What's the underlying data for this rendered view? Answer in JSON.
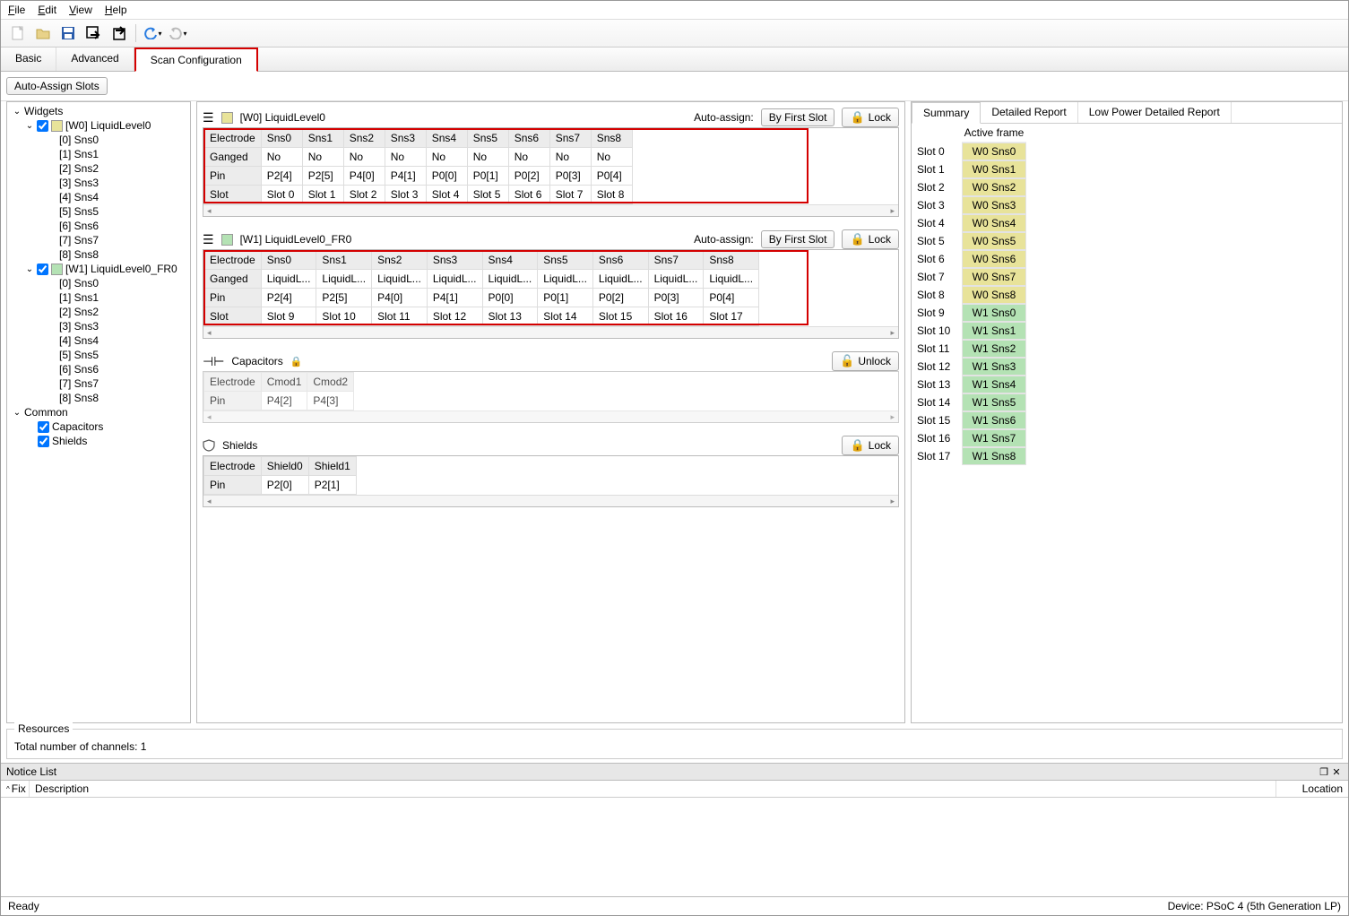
{
  "menubar": {
    "file": "File",
    "edit": "Edit",
    "view": "View",
    "help": "Help"
  },
  "tabs": {
    "basic": "Basic",
    "advanced": "Advanced",
    "scanconfig": "Scan Configuration"
  },
  "subbar": {
    "autoassign": "Auto-Assign Slots"
  },
  "tree": {
    "widgets": "Widgets",
    "w0": {
      "label": "[W0] LiquidLevel0",
      "sns": [
        "[0] Sns0",
        "[1] Sns1",
        "[2] Sns2",
        "[3] Sns3",
        "[4] Sns4",
        "[5] Sns5",
        "[6] Sns6",
        "[7] Sns7",
        "[8] Sns8"
      ]
    },
    "w1": {
      "label": "[W1] LiquidLevel0_FR0",
      "sns": [
        "[0] Sns0",
        "[1] Sns1",
        "[2] Sns2",
        "[3] Sns3",
        "[4] Sns4",
        "[5] Sns5",
        "[6] Sns6",
        "[7] Sns7",
        "[8] Sns8"
      ]
    },
    "common": "Common",
    "caps": "Capacitors",
    "shields": "Shields"
  },
  "panels": {
    "autoassign_label": "Auto-assign:",
    "byfirstslot": "By First Slot",
    "lock": "Lock",
    "unlock": "Unlock",
    "w0": {
      "title": "[W0] LiquidLevel0",
      "rows": {
        "Electrode": [
          "Sns0",
          "Sns1",
          "Sns2",
          "Sns3",
          "Sns4",
          "Sns5",
          "Sns6",
          "Sns7",
          "Sns8"
        ],
        "Ganged": [
          "No",
          "No",
          "No",
          "No",
          "No",
          "No",
          "No",
          "No",
          "No"
        ],
        "Pin": [
          "P2[4]",
          "P2[5]",
          "P4[0]",
          "P4[1]",
          "P0[0]",
          "P0[1]",
          "P0[2]",
          "P0[3]",
          "P0[4]"
        ],
        "Slot": [
          "Slot 0",
          "Slot 1",
          "Slot 2",
          "Slot 3",
          "Slot 4",
          "Slot 5",
          "Slot 6",
          "Slot 7",
          "Slot 8"
        ]
      }
    },
    "w1": {
      "title": "[W1] LiquidLevel0_FR0",
      "rows": {
        "Electrode": [
          "Sns0",
          "Sns1",
          "Sns2",
          "Sns3",
          "Sns4",
          "Sns5",
          "Sns6",
          "Sns7",
          "Sns8"
        ],
        "Ganged": [
          "LiquidL...",
          "LiquidL...",
          "LiquidL...",
          "LiquidL...",
          "LiquidL...",
          "LiquidL...",
          "LiquidL...",
          "LiquidL...",
          "LiquidL..."
        ],
        "Pin": [
          "P2[4]",
          "P2[5]",
          "P4[0]",
          "P4[1]",
          "P0[0]",
          "P0[1]",
          "P0[2]",
          "P0[3]",
          "P0[4]"
        ],
        "Slot": [
          "Slot 9",
          "Slot 10",
          "Slot 11",
          "Slot 12",
          "Slot 13",
          "Slot 14",
          "Slot 15",
          "Slot 16",
          "Slot 17"
        ]
      }
    },
    "caps": {
      "title": "Capacitors",
      "rows": {
        "Electrode": [
          "Cmod1",
          "Cmod2"
        ],
        "Pin": [
          "P4[2]",
          "P4[3]"
        ]
      }
    },
    "shields": {
      "title": "Shields",
      "rows": {
        "Electrode": [
          "Shield0",
          "Shield1"
        ],
        "Pin": [
          "P2[0]",
          "P2[1]"
        ]
      }
    }
  },
  "summary": {
    "tab_summary": "Summary",
    "tab_detailed": "Detailed Report",
    "tab_lowpower": "Low Power Detailed Report",
    "active_frame": "Active frame",
    "slots": [
      {
        "slot": "Slot 0",
        "val": "W0 Sns0",
        "cls": "y"
      },
      {
        "slot": "Slot 1",
        "val": "W0 Sns1",
        "cls": "y"
      },
      {
        "slot": "Slot 2",
        "val": "W0 Sns2",
        "cls": "y"
      },
      {
        "slot": "Slot 3",
        "val": "W0 Sns3",
        "cls": "y"
      },
      {
        "slot": "Slot 4",
        "val": "W0 Sns4",
        "cls": "y"
      },
      {
        "slot": "Slot 5",
        "val": "W0 Sns5",
        "cls": "y"
      },
      {
        "slot": "Slot 6",
        "val": "W0 Sns6",
        "cls": "y"
      },
      {
        "slot": "Slot 7",
        "val": "W0 Sns7",
        "cls": "y"
      },
      {
        "slot": "Slot 8",
        "val": "W0 Sns8",
        "cls": "y"
      },
      {
        "slot": "Slot 9",
        "val": "W1 Sns0",
        "cls": "g"
      },
      {
        "slot": "Slot 10",
        "val": "W1 Sns1",
        "cls": "g"
      },
      {
        "slot": "Slot 11",
        "val": "W1 Sns2",
        "cls": "g"
      },
      {
        "slot": "Slot 12",
        "val": "W1 Sns3",
        "cls": "g"
      },
      {
        "slot": "Slot 13",
        "val": "W1 Sns4",
        "cls": "g"
      },
      {
        "slot": "Slot 14",
        "val": "W1 Sns5",
        "cls": "g"
      },
      {
        "slot": "Slot 15",
        "val": "W1 Sns6",
        "cls": "g"
      },
      {
        "slot": "Slot 16",
        "val": "W1 Sns7",
        "cls": "g"
      },
      {
        "slot": "Slot 17",
        "val": "W1 Sns8",
        "cls": "g"
      }
    ]
  },
  "resources": {
    "legend": "Resources",
    "channels": "Total number of channels: 1"
  },
  "notice": {
    "title": "Notice List",
    "fix": "Fix",
    "desc": "Description",
    "loc": "Location"
  },
  "status": {
    "ready": "Ready",
    "device": "Device: PSoC 4 (5th Generation LP)"
  }
}
